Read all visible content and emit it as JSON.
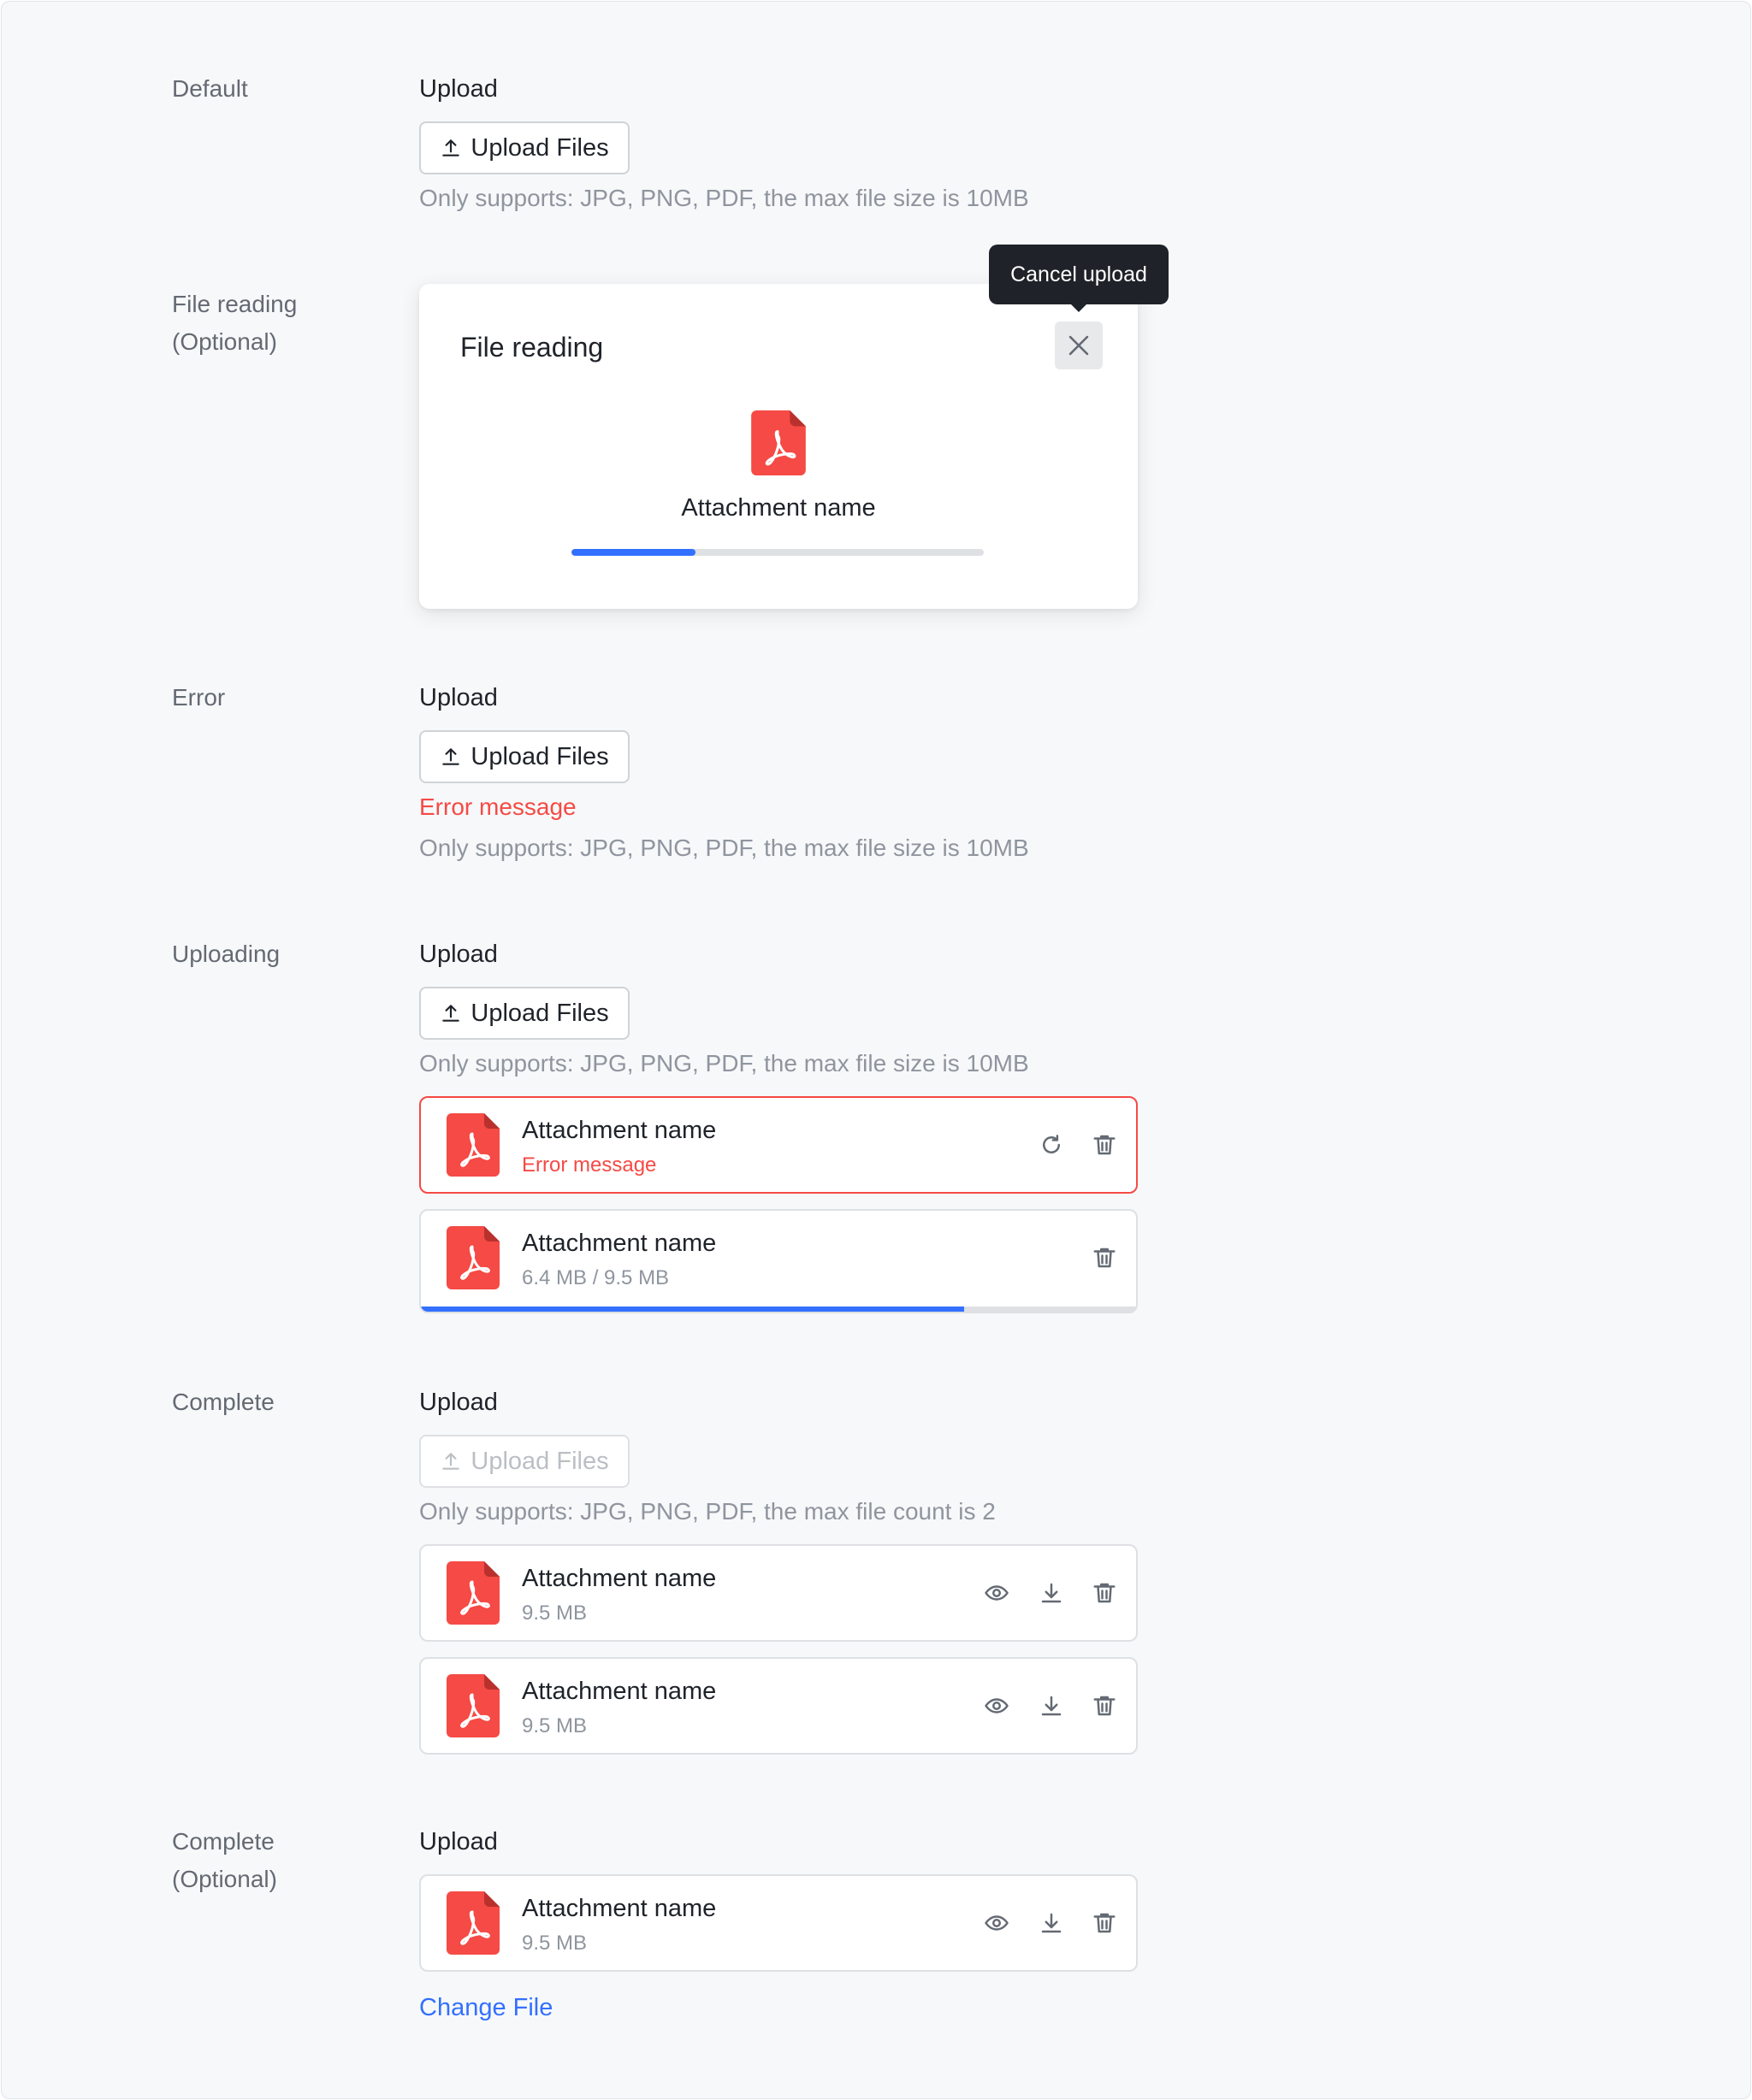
{
  "colors": {
    "accent": "#3370ff",
    "error": "#f54a45",
    "pdf_icon": "#f54a45",
    "text_primary": "#1f2329",
    "text_secondary": "#8f959e"
  },
  "sections": {
    "default": {
      "row_label": "Default",
      "field_label": "Upload",
      "button_label": "Upload Files",
      "hint": "Only supports: JPG, PNG, PDF, the max file size is 10MB"
    },
    "file_reading": {
      "row_label": "File reading\n(Optional)",
      "dialog_title": "File reading",
      "tooltip": "Cancel upload",
      "file_name": "Attachment name",
      "progress": 0.3
    },
    "error": {
      "row_label": "Error",
      "field_label": "Upload",
      "button_label": "Upload Files",
      "error_message": "Error message",
      "hint": "Only supports: JPG, PNG, PDF, the max file size is 10MB"
    },
    "uploading": {
      "row_label": "Uploading",
      "field_label": "Upload",
      "button_label": "Upload Files",
      "hint": "Only supports: JPG, PNG, PDF, the max file size is 10MB",
      "files": [
        {
          "name": "Attachment name",
          "meta": "Error message",
          "state": "error"
        },
        {
          "name": "Attachment name",
          "meta": "6.4 MB / 9.5 MB",
          "state": "uploading",
          "progress": 0.76
        }
      ]
    },
    "complete": {
      "row_label": "Complete",
      "field_label": "Upload",
      "button_label": "Upload Files",
      "button_disabled": true,
      "hint": "Only supports: JPG, PNG, PDF, the max file count is 2",
      "files": [
        {
          "name": "Attachment name",
          "meta": "9.5 MB"
        },
        {
          "name": "Attachment name",
          "meta": "9.5 MB"
        }
      ]
    },
    "complete_optional": {
      "row_label": "Complete\n(Optional)",
      "field_label": "Upload",
      "files": [
        {
          "name": "Attachment name",
          "meta": "9.5 MB"
        }
      ],
      "link_label": "Change File"
    }
  },
  "icons": [
    "upload-icon",
    "pdf-file-icon",
    "close-icon",
    "retry-icon",
    "delete-icon",
    "preview-icon",
    "download-icon"
  ]
}
